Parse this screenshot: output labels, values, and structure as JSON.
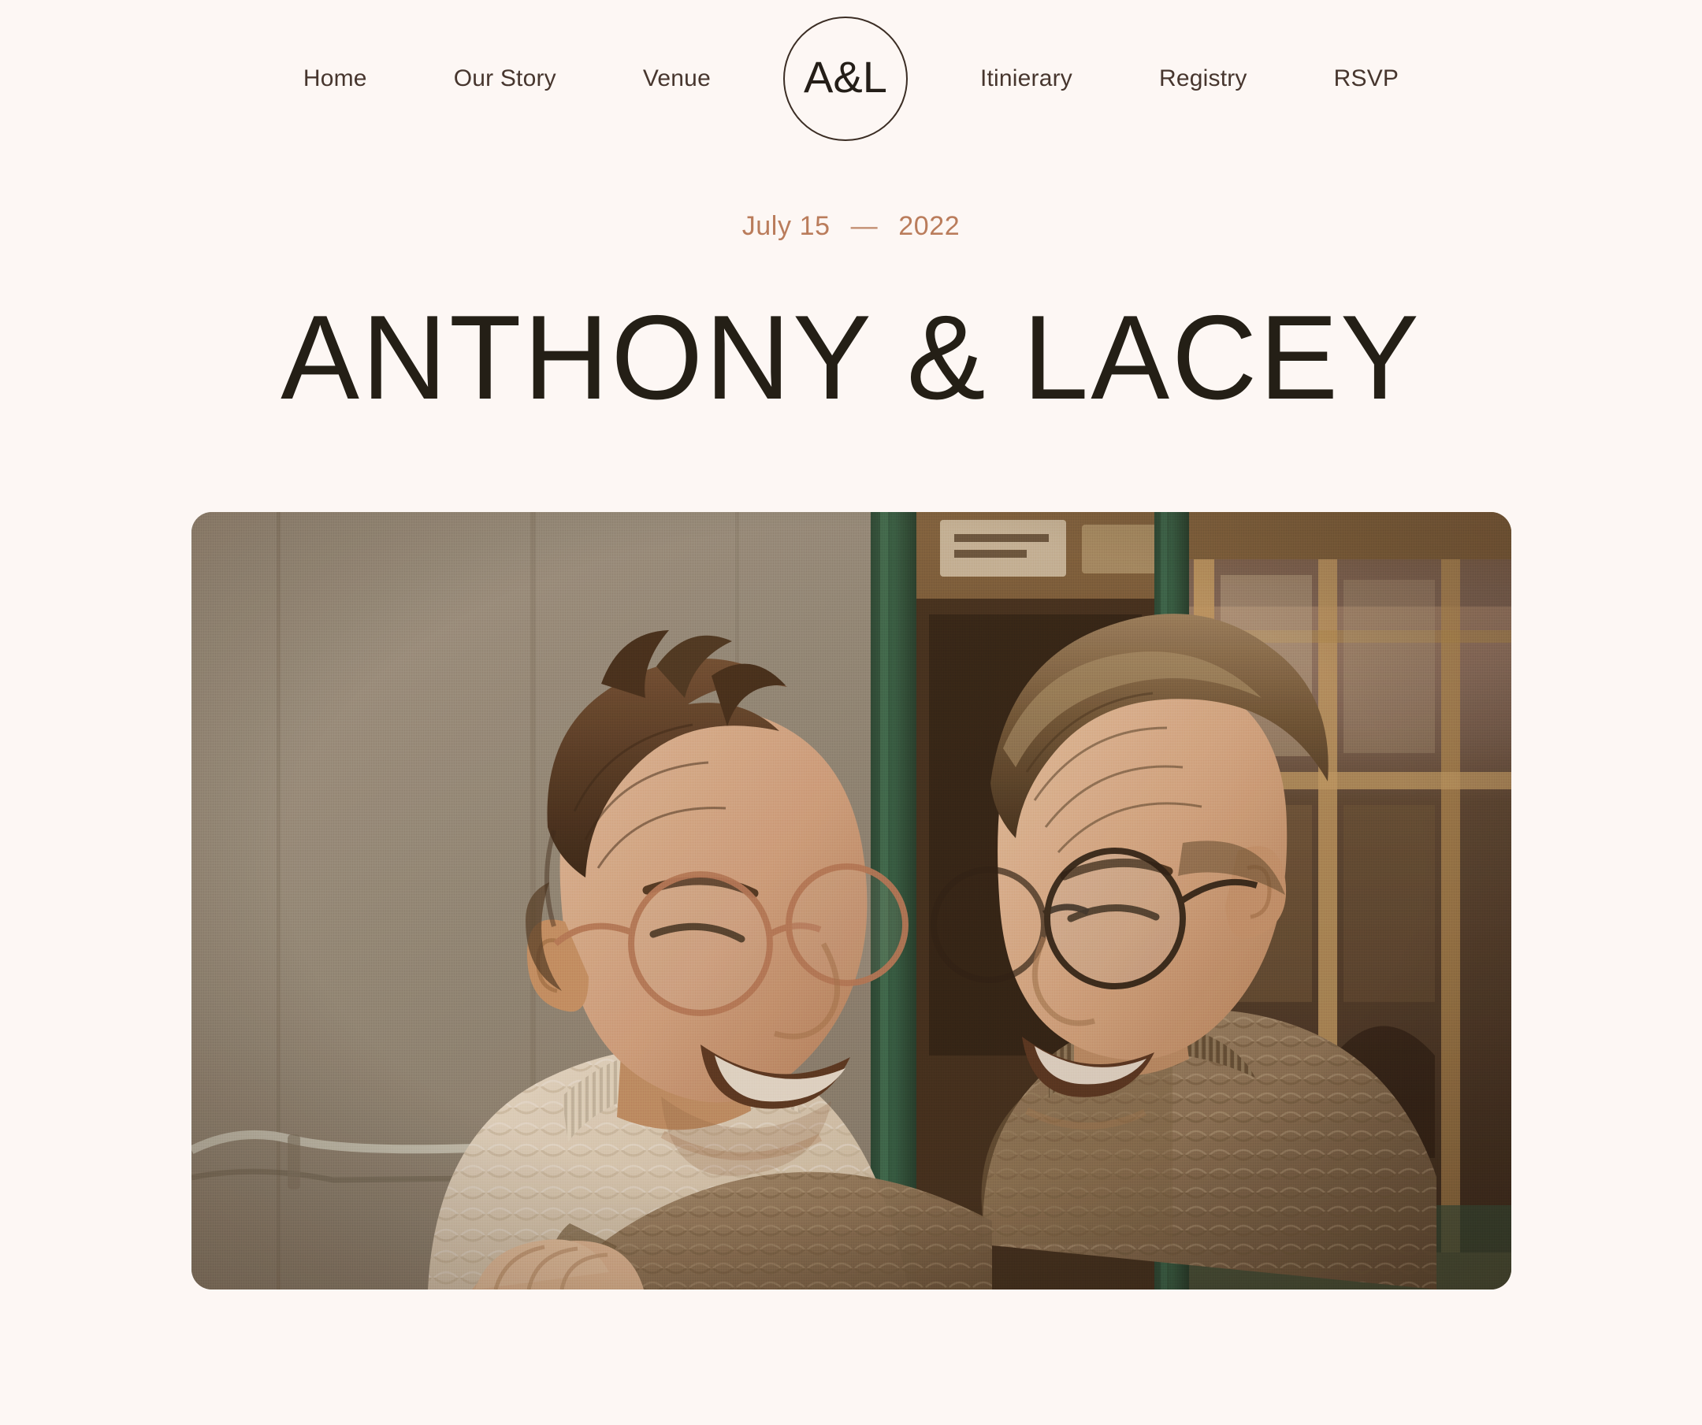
{
  "site": {
    "background_color": "#FDF7F4",
    "accent_color": "#BA7C5B",
    "text_color": "#241F16",
    "nav_text_color": "#47362E"
  },
  "nav": {
    "logo": {
      "text": "A&L",
      "icon": "circle-monogram-logo"
    },
    "left_items": [
      {
        "label": "Home"
      },
      {
        "label": "Our Story"
      },
      {
        "label": "Venue"
      }
    ],
    "right_items": [
      {
        "label": "Itinierary"
      },
      {
        "label": "Registry"
      },
      {
        "label": "RSVP"
      }
    ]
  },
  "hero": {
    "date": {
      "day": "July 15",
      "separator": "—",
      "year": "2022"
    },
    "couple_name": "ANTHONY & LACEY",
    "photo": {
      "alt": "Two smiling men embracing on a city street outside a shop with a green door frame",
      "corner_radius": "26px"
    }
  }
}
